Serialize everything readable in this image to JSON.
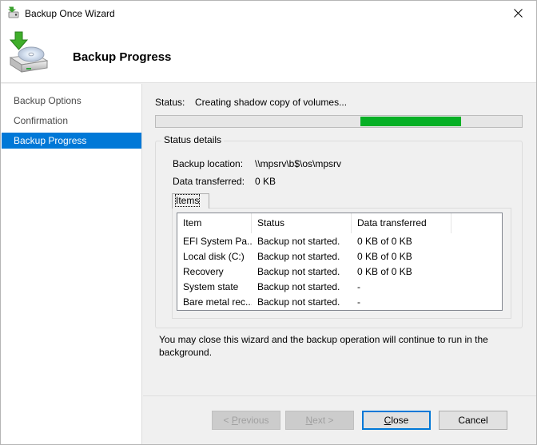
{
  "window": {
    "title": "Backup Once Wizard"
  },
  "header": {
    "title": "Backup Progress"
  },
  "nav": {
    "items": [
      {
        "label": "Backup Options",
        "active": false
      },
      {
        "label": "Confirmation",
        "active": false
      },
      {
        "label": "Backup Progress",
        "active": true
      }
    ]
  },
  "status": {
    "label": "Status:",
    "value": "Creating shadow copy of volumes...",
    "progress_segment": {
      "start_fraction": 0.56,
      "end_fraction": 0.835
    },
    "progress_color": "#06b025"
  },
  "details": {
    "title": "Status details",
    "backup_location_label": "Backup location:",
    "backup_location_value": "\\\\mpsrv\\b$\\os\\mpsrv",
    "data_transferred_label": "Data transferred:",
    "data_transferred_value": "0 KB"
  },
  "items": {
    "tab_label": "Items",
    "columns": [
      "Item",
      "Status",
      "Data transferred"
    ],
    "rows": [
      [
        "EFI System Pa...",
        "Backup not started.",
        "0 KB of 0 KB"
      ],
      [
        "Local disk (C:)",
        "Backup not started.",
        "0 KB of 0 KB"
      ],
      [
        "Recovery",
        "Backup not started.",
        "0 KB of 0 KB"
      ],
      [
        "System state",
        "Backup not started.",
        "-"
      ],
      [
        "Bare metal rec...",
        "Backup not started.",
        "-"
      ]
    ]
  },
  "note": "You may close this wizard and the backup operation will continue to run in the background.",
  "buttons": {
    "previous": {
      "pre": "< ",
      "ul": "P",
      "post": "revious"
    },
    "next": {
      "pre": "",
      "ul": "N",
      "post": "ext >"
    },
    "close": {
      "pre": "",
      "ul": "C",
      "post": "lose"
    },
    "cancel": {
      "pre": "Cancel",
      "ul": "",
      "post": ""
    }
  },
  "colors": {
    "accent": "#0078d7"
  }
}
